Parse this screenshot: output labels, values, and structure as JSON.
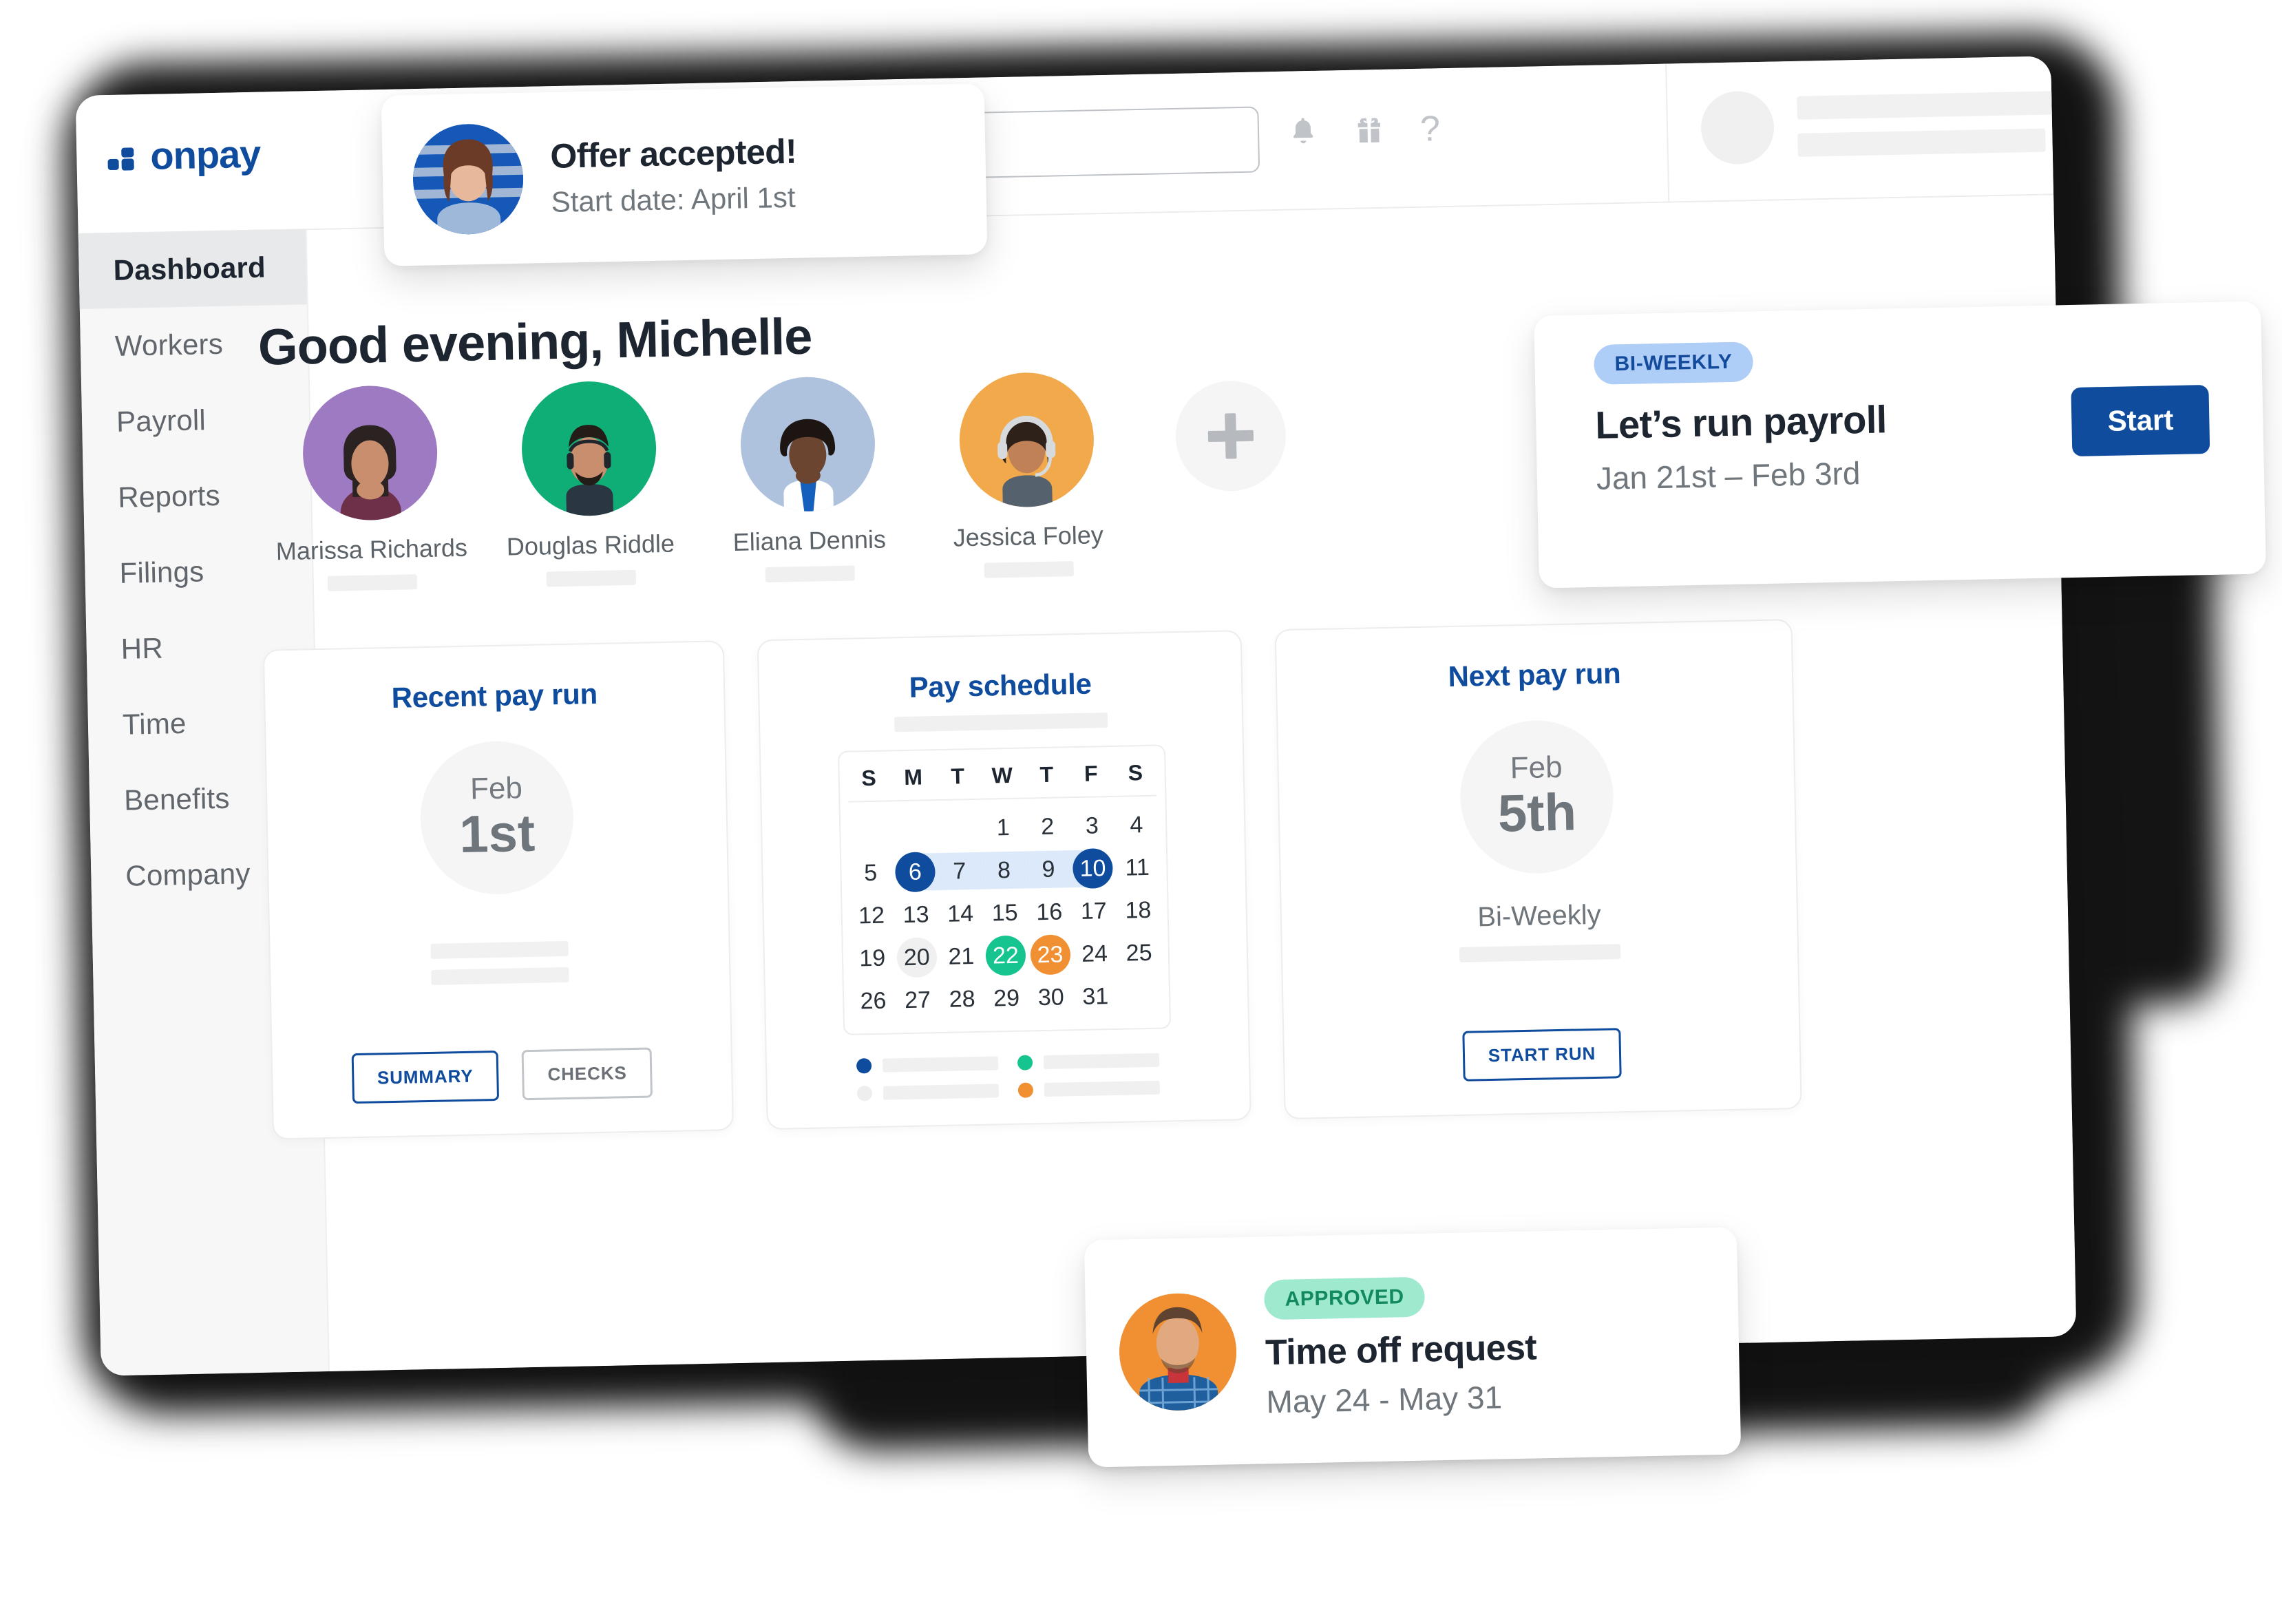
{
  "brand": {
    "name": "onpay",
    "primary_color": "#0f4c9e",
    "accent_green": "#15c48e",
    "accent_orange": "#f09033"
  },
  "header": {
    "search_placeholder": "",
    "icons": [
      "bell-icon",
      "gift-icon",
      "help-icon"
    ],
    "user_menu_chevron": "chevron-down-icon"
  },
  "sidebar": {
    "items": [
      {
        "label": "Dashboard",
        "active": true
      },
      {
        "label": "Workers",
        "active": false
      },
      {
        "label": "Payroll",
        "active": false
      },
      {
        "label": "Reports",
        "active": false
      },
      {
        "label": "Filings",
        "active": false
      },
      {
        "label": "HR",
        "active": false
      },
      {
        "label": "Time",
        "active": false
      },
      {
        "label": "Benefits",
        "active": false
      },
      {
        "label": "Company",
        "active": false
      }
    ]
  },
  "main": {
    "greeting": "Good evening, Michelle",
    "employees": [
      {
        "name": "Marissa Richards",
        "bg": "#9e7ac2"
      },
      {
        "name": "Douglas Riddle",
        "bg": "#0fae76"
      },
      {
        "name": "Eliana Dennis",
        "bg": "#aec2de"
      },
      {
        "name": "Jessica Foley",
        "bg": "#f2a94b"
      }
    ],
    "add_employee_label": "+"
  },
  "cards": {
    "recent_pay_run": {
      "title": "Recent pay run",
      "month": "Feb",
      "day": "1st",
      "buttons": [
        {
          "label": "SUMMARY",
          "style": "primary"
        },
        {
          "label": "CHECKS",
          "style": "ghost"
        }
      ]
    },
    "pay_schedule": {
      "title": "Pay schedule",
      "calendar": {
        "weekday_headers": [
          "S",
          "M",
          "T",
          "W",
          "T",
          "F",
          "S"
        ],
        "lead_blanks": 3,
        "days": [
          1,
          2,
          3,
          4,
          5,
          6,
          7,
          8,
          9,
          10,
          11,
          12,
          13,
          14,
          15,
          16,
          17,
          18,
          19,
          20,
          21,
          22,
          23,
          24,
          25,
          26,
          27,
          28,
          29,
          30,
          31
        ],
        "range_start": 6,
        "range_end": 10,
        "marks": [
          {
            "day": 6,
            "color": "navy",
            "text": "white"
          },
          {
            "day": 10,
            "color": "navy",
            "text": "white"
          },
          {
            "day": 20,
            "color": "gray",
            "text": "dark"
          },
          {
            "day": 22,
            "color": "green",
            "text": "white"
          },
          {
            "day": 23,
            "color": "orange",
            "text": "white"
          }
        ]
      },
      "legend": [
        {
          "color": "#0f4c9e"
        },
        {
          "color": "#15c48e"
        },
        {
          "color": "#eeeeef"
        },
        {
          "color": "#f09033"
        }
      ]
    },
    "next_pay_run": {
      "title": "Next pay run",
      "month": "Feb",
      "day": "5th",
      "cadence": "Bi-Weekly",
      "button": {
        "label": "START RUN",
        "style": "primary"
      }
    }
  },
  "floating": {
    "offer": {
      "title": "Offer accepted!",
      "subtitle": "Start date: April 1st"
    },
    "payroll": {
      "badge": "BI-WEEKLY",
      "title": "Let’s run payroll",
      "subtitle": "Jan 21st – Feb 3rd",
      "button_label": "Start"
    },
    "timeoff": {
      "badge": "APPROVED",
      "title": "Time off request",
      "subtitle": "May 24 - May 31"
    }
  }
}
